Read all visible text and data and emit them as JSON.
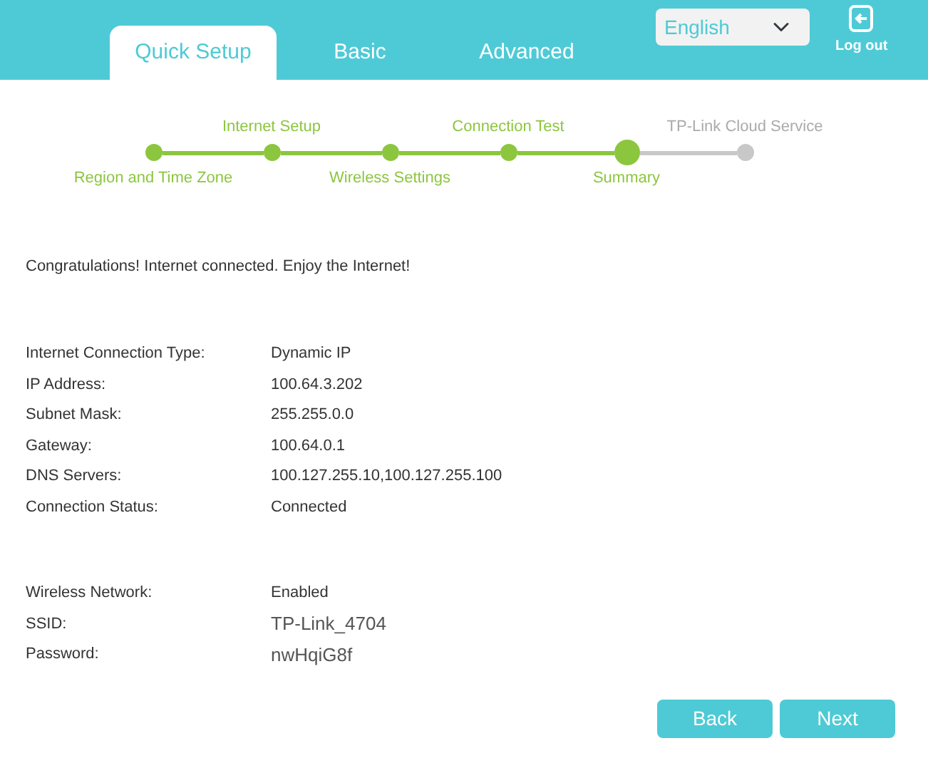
{
  "tabs": [
    {
      "label": "Quick Setup",
      "selected": true
    },
    {
      "label": "Basic",
      "selected": false
    },
    {
      "label": "Advanced",
      "selected": false
    }
  ],
  "language": {
    "value": "English"
  },
  "logout": {
    "label": "Log out"
  },
  "steps": [
    {
      "label": "Region and Time Zone",
      "completed": true,
      "selected": false
    },
    {
      "label": "Internet Setup",
      "completed": true,
      "selected": false
    },
    {
      "label": "Wireless Settings",
      "completed": true,
      "selected": false
    },
    {
      "label": "Connection Test",
      "completed": true,
      "selected": false
    },
    {
      "label": "Summary",
      "completed": false,
      "selected": true
    },
    {
      "label": "TP-Link Cloud Service",
      "completed": false,
      "selected": false
    }
  ],
  "message": "Congratulations! Internet connected. Enjoy the Internet!",
  "sections": [
    {
      "rows": [
        {
          "label": "Internet Connection Type:",
          "value": "Dynamic IP",
          "kind": "plain"
        },
        {
          "label": "IP Address:",
          "value": "100.64.3.202",
          "kind": "plain"
        },
        {
          "label": "Subnet Mask:",
          "value": "255.255.0.0",
          "kind": "plain"
        },
        {
          "label": "Gateway:",
          "value": "100.64.0.1",
          "kind": "plain"
        },
        {
          "label": "DNS Servers:",
          "value": "100.127.255.10,100.127.255.100",
          "kind": "plain"
        },
        {
          "label": "Connection Status:",
          "value": "Connected",
          "kind": "plain"
        }
      ]
    },
    {
      "rows": [
        {
          "label": "Wireless Network:",
          "value": "Enabled",
          "kind": "plain"
        },
        {
          "label": "SSID:",
          "value": "TP-Link_4704",
          "kind": "large"
        },
        {
          "label": "Password:",
          "value": "nwHqiG8f",
          "kind": "large"
        }
      ]
    }
  ],
  "buttons": [
    "Back",
    "Next"
  ]
}
